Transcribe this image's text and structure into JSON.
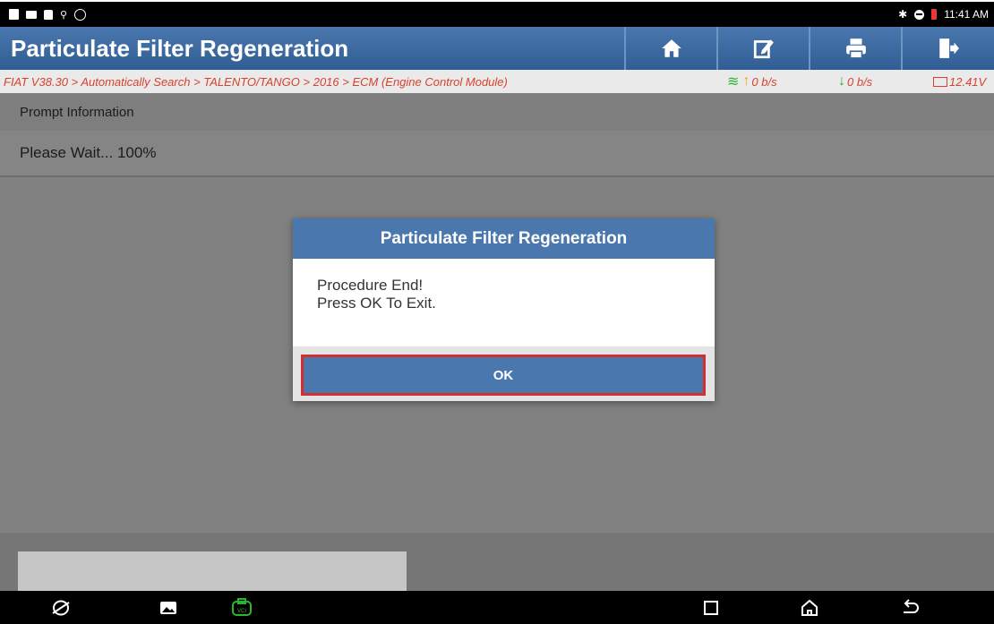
{
  "statusbar": {
    "time": "11:41 AM",
    "left_icons": [
      "battery-alert-icon",
      "image-icon",
      "bag-icon",
      "usb-icon",
      "accessibility-icon"
    ],
    "right_icons": [
      "bluetooth-icon",
      "do-not-disturb-icon",
      "battery-low-icon"
    ]
  },
  "header": {
    "title": "Particulate Filter Regeneration",
    "buttons": [
      "home-icon",
      "edit-icon",
      "print-icon",
      "exit-icon"
    ]
  },
  "breadcrumb": {
    "path": "FIAT V38.30 > Automatically Search > TALENTO/TANGO > 2016 > ECM (Engine Control Module)",
    "upload": "0 b/s",
    "download": "0 b/s",
    "voltage": "12.41V"
  },
  "content": {
    "prompt_label": "Prompt Information",
    "prompt_text": "Please Wait... 100%"
  },
  "dialog": {
    "title": "Particulate Filter Regeneration",
    "line1": "Procedure End!",
    "line2": "Press OK To Exit.",
    "ok_label": "OK"
  },
  "colors": {
    "header": "#3b6aa3",
    "breadcrumb_text": "#d9412c",
    "ok_border": "#d32f2f",
    "vci_icon": "#2bb52f"
  }
}
